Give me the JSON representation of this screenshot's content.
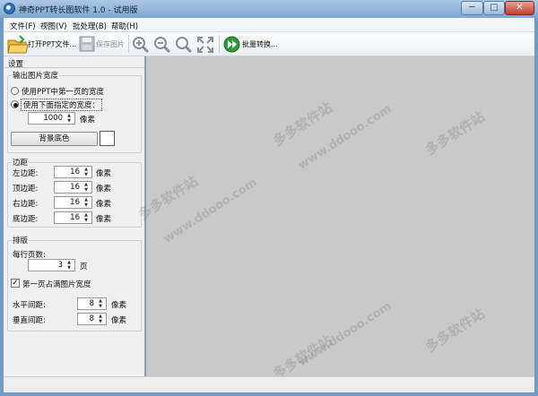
{
  "window": {
    "title": "神奇PPT转长图软件 1.0 - 试用版",
    "min": "─",
    "max": "□",
    "close": "✕"
  },
  "menu": [
    "文件(F)",
    "视图(V)",
    "批处理(B)",
    "帮助(H)"
  ],
  "toolbar": {
    "open": "打开PPT文件...",
    "save": "保存图片",
    "batch": "批量转换..."
  },
  "panel": {
    "title": "设置",
    "width_group": {
      "title": "输出图片宽度",
      "opt1": "使用PPT中第一页的宽度",
      "opt2": "使用下面指定的宽度：",
      "selected": 2,
      "width_value": "1000",
      "unit": "像素",
      "bg_button": "背景底色",
      "bg_color": "#ffffff"
    },
    "margin_group": {
      "title": "边距",
      "rows": [
        {
          "label": "左边距:",
          "value": "16",
          "unit": "像素"
        },
        {
          "label": "顶边距:",
          "value": "16",
          "unit": "像素"
        },
        {
          "label": "右边距:",
          "value": "16",
          "unit": "像素"
        },
        {
          "label": "底边距:",
          "value": "16",
          "unit": "像素"
        }
      ]
    },
    "layout_group": {
      "title": "排版",
      "per_row_label": "每行页数:",
      "per_row_value": "3",
      "per_row_unit": "页",
      "first_full": "第一页占满图片宽度",
      "first_full_checked": true,
      "hgap_label": "水平间距:",
      "hgap_value": "8",
      "hgap_unit": "像素",
      "vgap_label": "垂直间距:",
      "vgap_value": "8",
      "vgap_unit": "像素"
    }
  },
  "watermark": {
    "text1": "多多软件站",
    "text2": "www.ddooo.com"
  }
}
